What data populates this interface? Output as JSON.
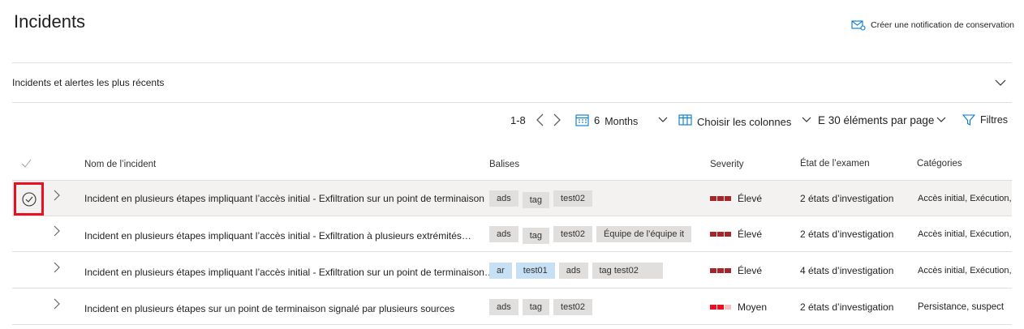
{
  "page": {
    "title": "Incidents",
    "notify_label": "Créer une notification de conservation"
  },
  "section": {
    "label": "Incidents et alertes les plus récents"
  },
  "toolbar": {
    "pagination": "1-8",
    "range_number": "6",
    "range_unit": "Months",
    "choose_columns": "Choisir les colonnes",
    "per_page": "E 30 éléments par page",
    "filters": "Filtres"
  },
  "columns": {
    "name": "Nom de l’incident",
    "tags": "Balises",
    "severity": "Severity",
    "investigation": "État de l’examen",
    "categories": "Catégories"
  },
  "rows": [
    {
      "name": "Incident en plusieurs étapes impliquant l’accès initial - Exfiltration sur un point de terminaison",
      "tags": [
        "ads",
        "tag",
        "test02"
      ],
      "severity": "Élevé",
      "investigation": "2 états d’investigation",
      "categories": "Accès initial, Exécution,"
    },
    {
      "name": "Incident en plusieurs étapes impliquant l’accès initial - Exfiltration à plusieurs extrémités…",
      "tags": [
        "ads",
        "tag",
        "test02",
        "Équipe de l’équipe it"
      ],
      "severity": "Élevé",
      "investigation": "2 états d’investigation",
      "categories": "Accès initial, Exécution,"
    },
    {
      "name": "Incident en plusieurs étapes impliquant l’accès initial - Exfiltration sur un point de terminaison…",
      "tags": [
        "ar",
        "test01",
        "ads",
        "tag test02"
      ],
      "severity": "Élevé",
      "investigation": "4 états d’investigation",
      "categories": "Accès initial, Exécution,"
    },
    {
      "name": "Incident en plusieurs étapes sur un point de terminaison signalé par plusieurs sources",
      "tags": [
        "ads",
        "tag",
        "test02"
      ],
      "severity": "Moyen",
      "investigation": "2 états d’investigation",
      "categories": "Persistance, suspect"
    }
  ],
  "colors": {
    "severity_high": "#a4262c",
    "severity_medium": "#e81123",
    "tag_bg": "#e1dfdd",
    "tag_blue_bg": "#c7e0f4",
    "highlight_box": "#e81123"
  },
  "icons": {
    "notify": "mail-bell-icon",
    "section_toggle": "chevron-down-icon",
    "prev": "chevron-left-icon",
    "next": "chevron-right-icon",
    "calendar": "calendar-icon",
    "columns": "columns-icon",
    "filter": "filter-icon",
    "select": "circle-check-icon",
    "expand": "chevron-right-icon"
  }
}
